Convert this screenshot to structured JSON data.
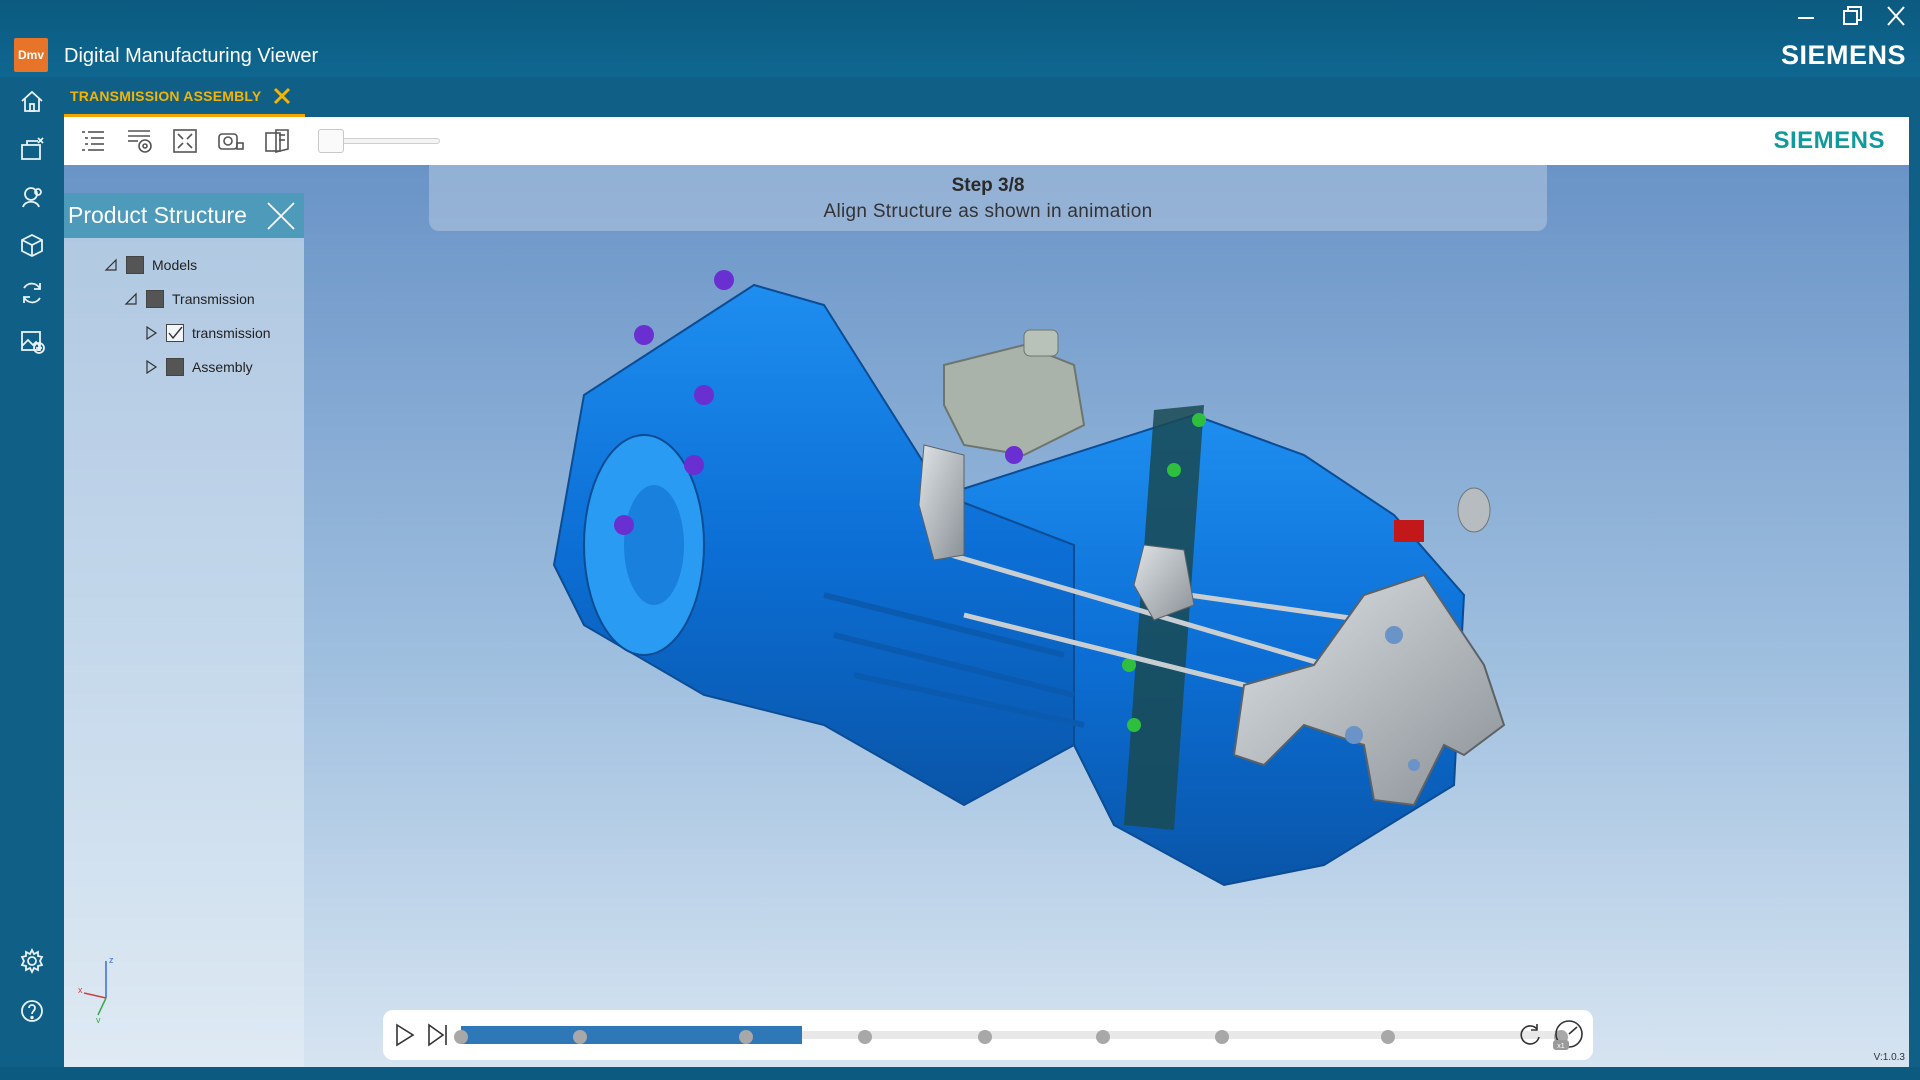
{
  "window": {
    "app_icon_text": "Dmv",
    "title": "Digital Manufacturing Viewer",
    "brand": "SIEMENS",
    "controls": [
      "minimize-icon",
      "restore-icon",
      "close-icon"
    ]
  },
  "rail": {
    "items": [
      "home-icon",
      "open-package-icon",
      "search-user-icon",
      "3d-model-icon",
      "refresh-icon",
      "add-image-icon"
    ],
    "bottom_items": [
      "settings-icon",
      "help-icon"
    ]
  },
  "tab": {
    "label": "TRANSMISSION ASSEMBLY",
    "accent": "#f5b400"
  },
  "toolbar": {
    "tools": [
      "list-icon",
      "settings-view-icon",
      "fit-screen-icon",
      "camera-icon",
      "section-view-icon"
    ],
    "brand": "SIEMENS",
    "brand_color": "#119a9c"
  },
  "step": {
    "title": "Step 3/8",
    "text": "Align Structure as shown in animation"
  },
  "product_structure": {
    "title": "Product Structure",
    "tree": [
      {
        "label": "Models",
        "level": 0,
        "expanded": true,
        "checked": false
      },
      {
        "label": "Transmission",
        "level": 1,
        "expanded": true,
        "checked": false
      },
      {
        "label": "transmission",
        "level": 2,
        "expanded": false,
        "checked": true
      },
      {
        "label": "Assembly",
        "level": 2,
        "expanded": false,
        "checked": false
      }
    ]
  },
  "axis": {
    "x": "x",
    "y": "y",
    "z": "z"
  },
  "timeline": {
    "total_steps": 8,
    "current_step": 3,
    "progress_fraction": 0.31,
    "stop_fractions": [
      0,
      0.108,
      0.259,
      0.367,
      0.476,
      0.584,
      0.692,
      0.843,
      1.0
    ],
    "speed_badge": "x1",
    "version": "V:1.0.3"
  }
}
